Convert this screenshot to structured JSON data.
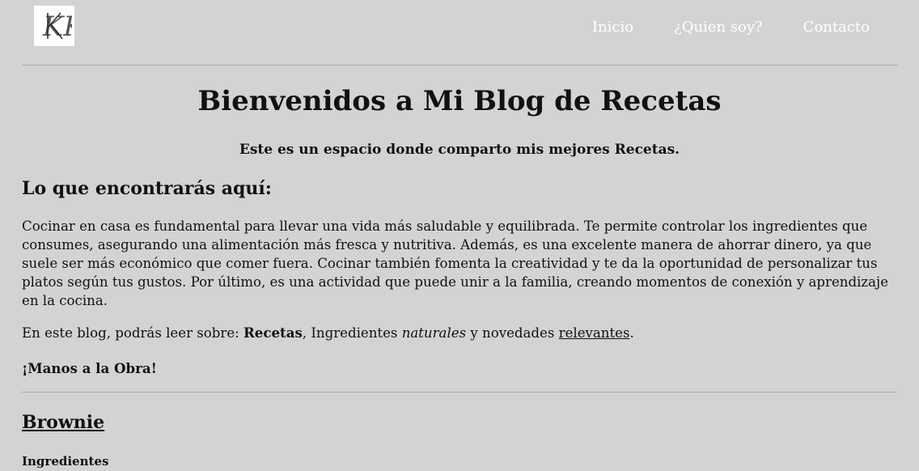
{
  "header": {
    "logo_text": "KK",
    "nav": [
      {
        "label": "Inicio"
      },
      {
        "label": "¿Quien soy?"
      },
      {
        "label": "Contacto"
      }
    ]
  },
  "main": {
    "title": "Bienvenidos a Mi Blog de Recetas",
    "subtitle": "Este es un espacio donde comparto mis mejores Recetas.",
    "section_heading": "Lo que encontrarás aquí:",
    "intro_paragraph": "Cocinar en casa es fundamental para llevar una vida más saludable y equilibrada. Te permite controlar los ingredientes que consumes, asegurando una alimentación más fresca y nutritiva. Además, es una excelente manera de ahorrar dinero, ya que suele ser más económico que comer fuera. Cocinar también fomenta la creatividad y te da la oportunidad de personalizar tus platos según tus gustos. Por último, es una actividad que puede unir a la familia, creando momentos de conexión y aprendizaje en la cocina.",
    "topics": {
      "lead": "En este blog, podrás leer sobre: ",
      "recetas": "Recetas",
      "sep1": ", Ingredientes ",
      "naturales": "naturales",
      "sep2": " y novedades ",
      "relevantes": "relevantes",
      "end": "."
    },
    "call_to_action": "¡Manos a la Obra!"
  },
  "recipe": {
    "title": "Brownie",
    "ingredients_heading": "Ingredientes"
  }
}
